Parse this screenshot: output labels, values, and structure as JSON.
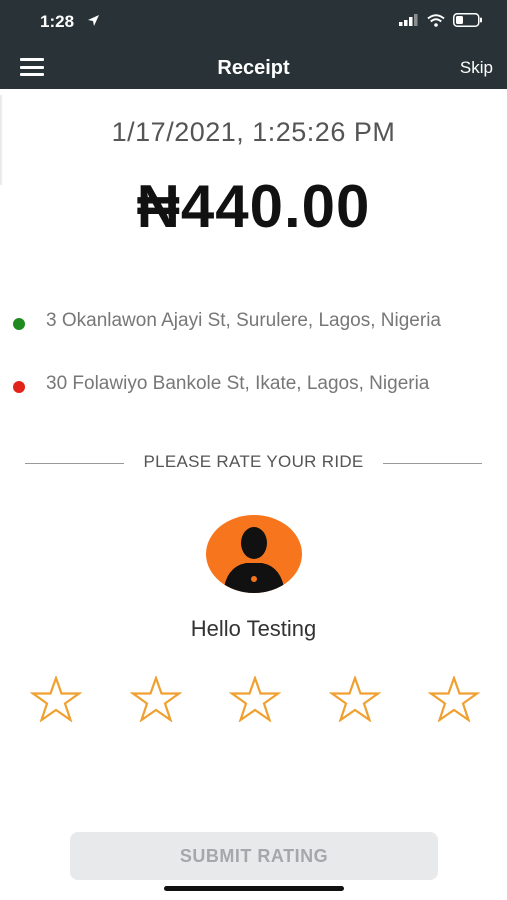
{
  "status_bar": {
    "time": "1:28",
    "location_icon": "location-arrow-icon",
    "signal_icon": "cellular-signal-icon",
    "wifi_icon": "wifi-icon",
    "battery_icon": "battery-icon"
  },
  "header": {
    "menu_icon": "hamburger-menu-icon",
    "title": "Receipt",
    "skip_label": "Skip",
    "background_color": "#293337"
  },
  "receipt": {
    "datetime": "1/17/2021, 1:25:26 PM",
    "amount": "₦440.00"
  },
  "trip": {
    "pickup": {
      "address": "3 Okanlawon Ajayi St, Surulere, Lagos, Nigeria",
      "dot_color": "#1f8a1f"
    },
    "dropoff": {
      "address": "30 Folawiyo Bankole St, Ikate, Lagos, Nigeria",
      "dot_color": "#e2231a"
    }
  },
  "rating": {
    "section_label": "PLEASE RATE YOUR RIDE",
    "driver_greeting": "Hello Testing",
    "avatar_color": "#f7761d",
    "star_color": "#f0a030",
    "stars_total": 5,
    "stars_selected": 0
  },
  "submit": {
    "label": "SUBMIT RATING"
  }
}
